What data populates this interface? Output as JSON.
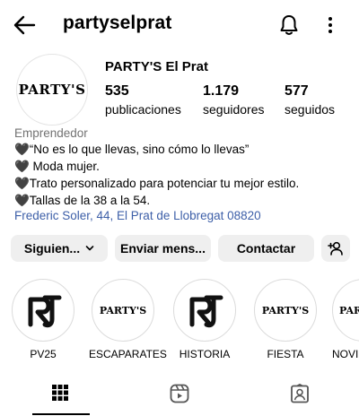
{
  "header": {
    "username": "partyselprat"
  },
  "profile": {
    "avatar_logo": "PARTY'S",
    "display_name": "PARTY'S El Prat",
    "stats": {
      "posts": {
        "value": "535",
        "label": "publicaciones"
      },
      "followers": {
        "value": "1.179",
        "label": "seguidores"
      },
      "following": {
        "value": "577",
        "label": "seguidos"
      }
    },
    "category": "Emprendedor",
    "bio_lines": [
      "🖤“No es lo que llevas, sino cómo lo llevas”",
      "🖤 Moda mujer.",
      "🖤Trato personalizado para potenciar tu mejor estilo.",
      "🖤Tallas de la 38 a la 54."
    ],
    "address": "Frederic Soler, 44, El Prat de Llobregat 08820"
  },
  "actions": {
    "following": "Siguien...",
    "message": "Enviar mens...",
    "contact": "Contactar"
  },
  "highlights": [
    {
      "label": "PV25",
      "cover_text": "PT"
    },
    {
      "label": "ESCAPARATES",
      "cover_text": "PARTY'S"
    },
    {
      "label": "HISTORIA",
      "cover_text": "PT"
    },
    {
      "label": "FIESTA",
      "cover_text": "PARTY'S"
    },
    {
      "label": "NOVI",
      "cover_text": "PARTY'S"
    }
  ],
  "tabs": [
    "grid-icon",
    "reels-icon",
    "tagged-icon"
  ]
}
